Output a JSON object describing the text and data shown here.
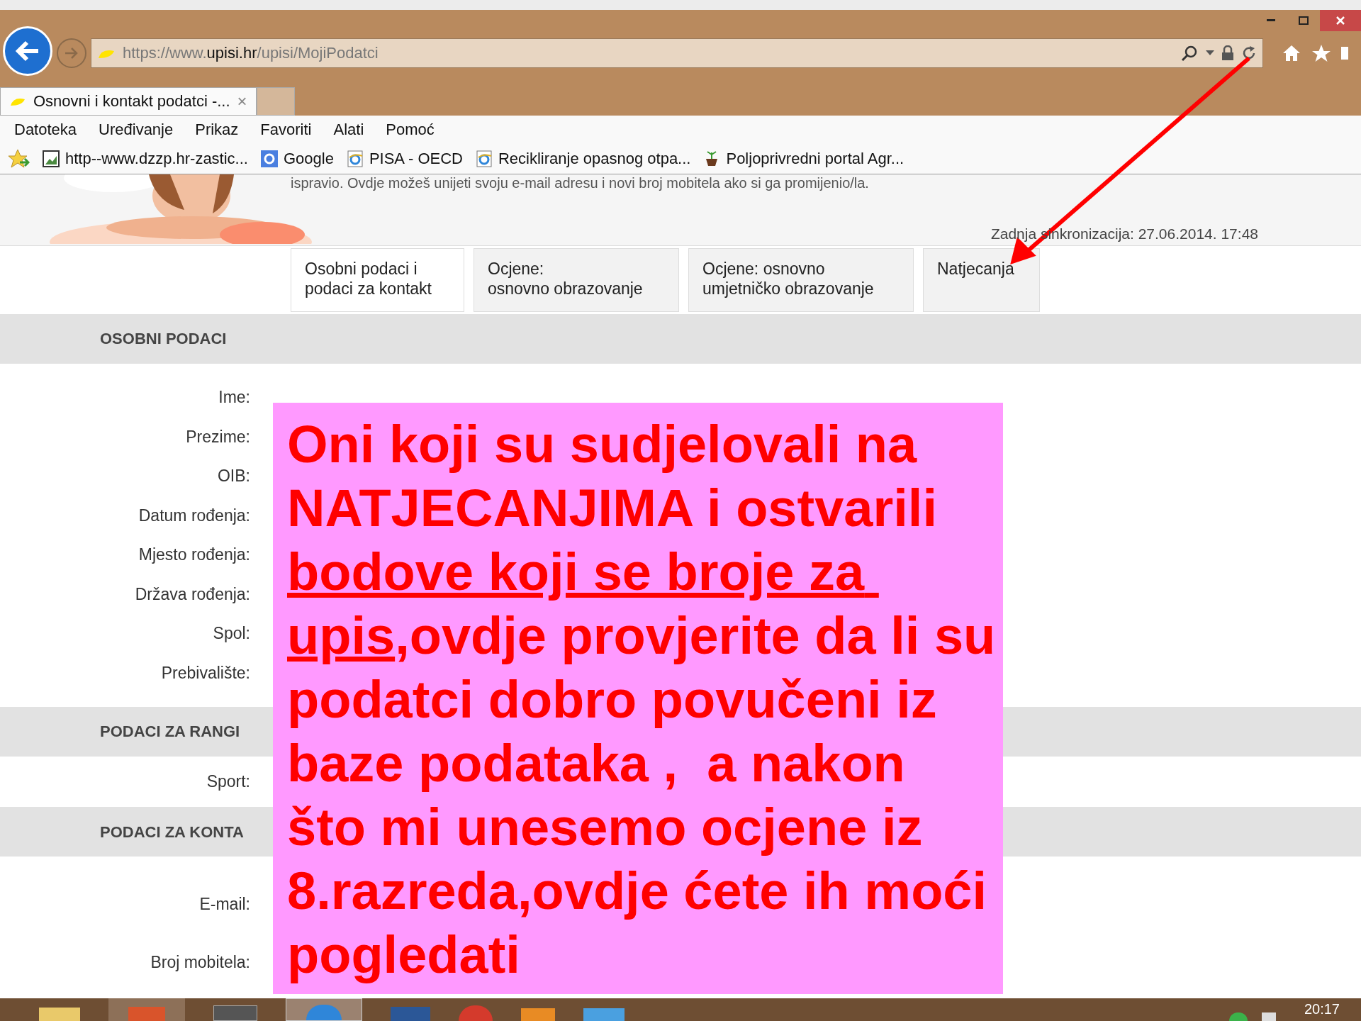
{
  "browser": {
    "url_parts": [
      {
        "text": "https://",
        "strong": false
      },
      {
        "text": "www.",
        "strong": false
      },
      {
        "text": "upisi.hr",
        "strong": true
      },
      {
        "text": "/upisi/MojiPodatci",
        "strong": false
      }
    ],
    "tabs": [
      {
        "label": "Osnovni i kontakt podatci -...",
        "selected": true,
        "close": "×"
      }
    ],
    "menu": [
      "Datoteka",
      "Uređivanje",
      "Prikaz",
      "Favoriti",
      "Alati",
      "Pomoć"
    ],
    "favorites": [
      {
        "label": "http--www.dzzp.hr-zastic...",
        "kind": "page"
      },
      {
        "label": "Google",
        "kind": "google"
      },
      {
        "label": "PISA - OECD",
        "kind": "ie"
      },
      {
        "label": "Recikliranje opasnog otpa...",
        "kind": "ie"
      },
      {
        "label": "Poljoprivredni portal  Agr...",
        "kind": "plant"
      }
    ]
  },
  "header": {
    "intro": "ispravio. Ovdje možeš unijeti svoju e-mail adresu i novi broj mobitela ako si ga promijenio/la.",
    "sync": "Zadnja sinkronizacija: 27.06.2014. 17:48"
  },
  "nav_tabs": [
    {
      "label": "Osobni podaci i\npodaci za kontakt",
      "selected": true
    },
    {
      "label": "Ocjene:\nosnovno obrazovanje",
      "selected": false
    },
    {
      "label": "Ocjene: osnovno\numjetničko obrazovanje",
      "selected": false
    },
    {
      "label": "Natjecanja",
      "selected": false
    }
  ],
  "sections": [
    {
      "title": "OSOBNI PODACI",
      "fields": [
        {
          "label": "Ime:",
          "kind": "text"
        },
        {
          "label": "Prezime:",
          "kind": "text"
        },
        {
          "label": "OIB:",
          "kind": "text"
        },
        {
          "label": "Datum rođenja:",
          "kind": "text"
        },
        {
          "label": "Mjesto rođenja:",
          "kind": "text"
        },
        {
          "label": "Država rođenja:",
          "kind": "text"
        },
        {
          "label": "Spol:",
          "kind": "text"
        },
        {
          "label": "Prebivalište:",
          "kind": "text"
        }
      ]
    },
    {
      "title": "PODACI ZA RANGI",
      "fields": [
        {
          "label": "Sport:",
          "kind": "text"
        }
      ]
    },
    {
      "title": "PODACI ZA KONTA",
      "fields": [
        {
          "label": "E-mail:",
          "kind": "input"
        },
        {
          "label": "Broj mobitela:",
          "kind": "input"
        }
      ]
    }
  ],
  "note": {
    "parts": [
      {
        "text": "Oni koji su sudjelovali na NATJECANJIMA i ostvarili ",
        "underline": false
      },
      {
        "text": "bodove koji se broje za upis",
        "underline": true
      },
      {
        "text": ",ovdje provjerite da li su podatci dobro povučeni iz baze podataka ,  a nakon što mi unesemo ocjene iz 8.razreda,ovdje ćete ih moći pogledati",
        "underline": false
      }
    ]
  },
  "taskbar": {
    "clock": "20:17"
  }
}
